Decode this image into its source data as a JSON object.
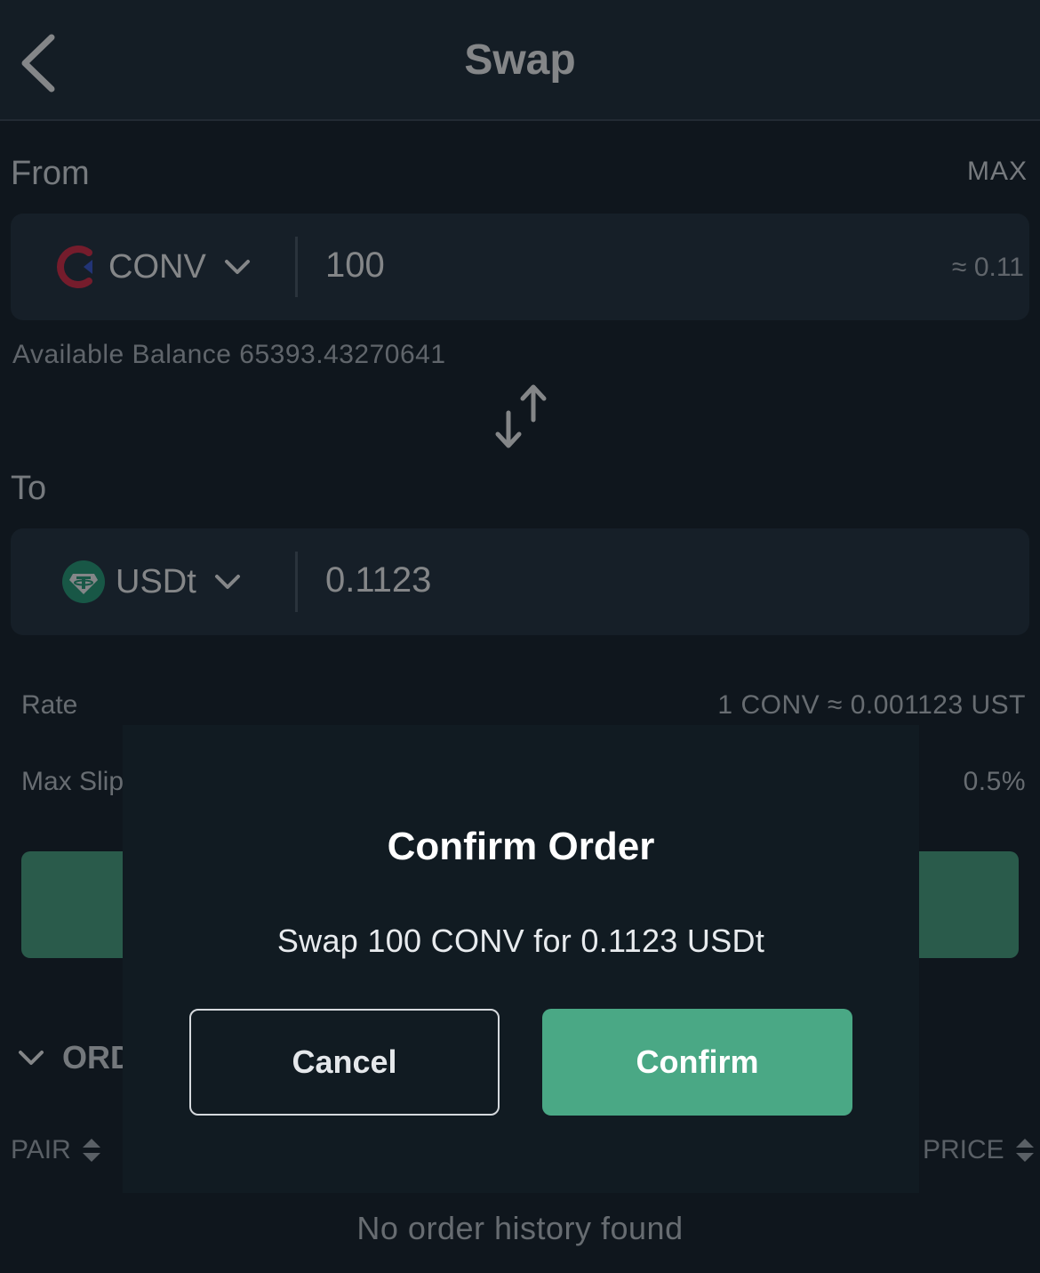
{
  "header": {
    "title": "Swap"
  },
  "from": {
    "label": "From",
    "max_label": "MAX",
    "token": "CONV",
    "amount": "100",
    "approx_value": "≈ 0.11",
    "balance": "Available Balance 65393.43270641"
  },
  "to": {
    "label": "To",
    "token": "USDt",
    "amount": "0.1123"
  },
  "info": {
    "rate_label": "Rate",
    "rate_value": "1 CONV ≈ 0.001123 UST",
    "slippage_label": "Max Slip",
    "slippage_value": "0.5%"
  },
  "orders": {
    "title": "ORD",
    "col_pair": "PAIR",
    "col_price": "PRICE",
    "empty": "No order history found"
  },
  "modal": {
    "title": "Confirm Order",
    "message": "Swap 100 CONV for 0.1123 USDt",
    "cancel_label": "Cancel",
    "confirm_label": "Confirm"
  },
  "colors": {
    "background": "#151f28",
    "field": "#22303e",
    "modal": "#111b22",
    "accent": "#4aa885"
  }
}
